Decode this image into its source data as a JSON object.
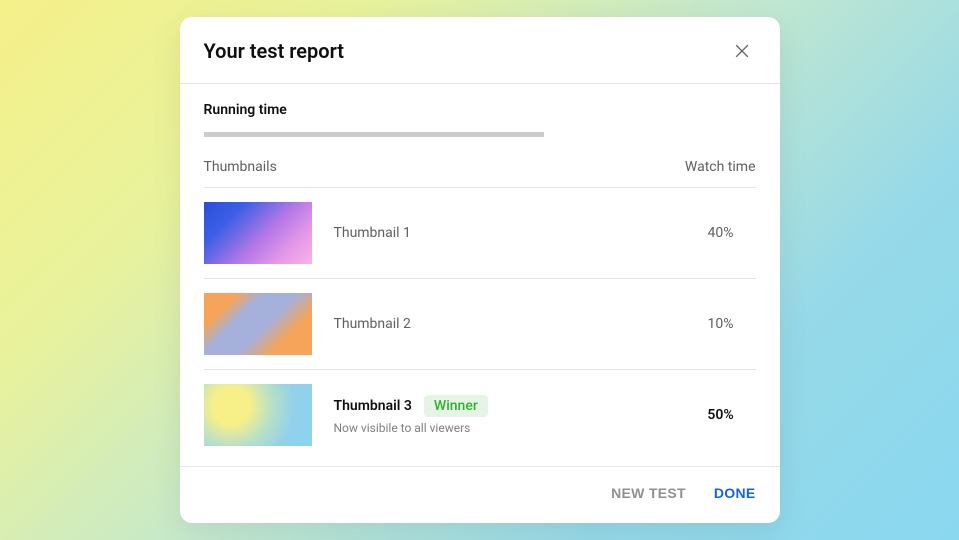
{
  "modal": {
    "title": "Your test report",
    "running_time_label": "Running time",
    "columns": {
      "thumbnails": "Thumbnails",
      "watch_time": "Watch time"
    },
    "rows": [
      {
        "name": "Thumbnail 1",
        "watch_time": "40%",
        "winner": false,
        "subtext": ""
      },
      {
        "name": "Thumbnail 2",
        "watch_time": "10%",
        "winner": false,
        "subtext": ""
      },
      {
        "name": "Thumbnail 3",
        "watch_time": "50%",
        "winner": true,
        "subtext": "Now visibile to all viewers"
      }
    ],
    "winner_badge": "Winner",
    "footer": {
      "new_test": "NEW TEST",
      "done": "DONE"
    }
  }
}
